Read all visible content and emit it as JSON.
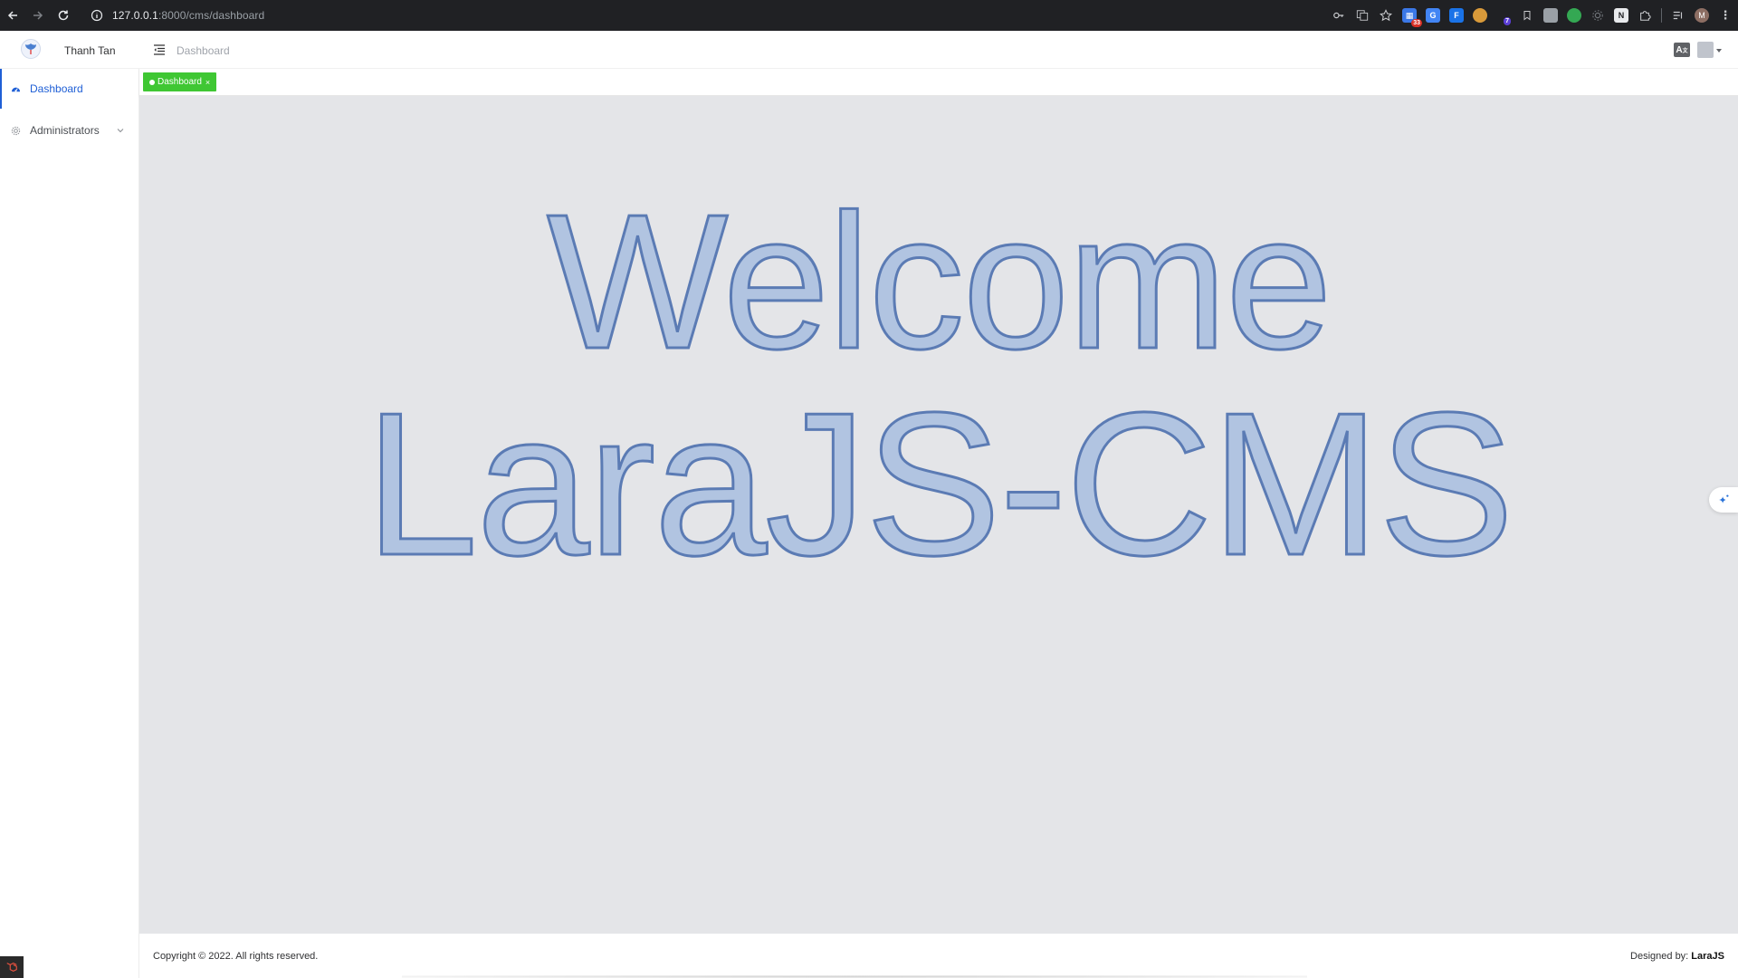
{
  "browser": {
    "url_host": "127.0.0.1",
    "url_path": ":8000/cms/dashboard",
    "extension_badges": {
      "first": "33",
      "second": "7"
    },
    "profile_initial": "M"
  },
  "header": {
    "user_name": "Thanh Tan",
    "breadcrumb": "Dashboard",
    "lang_icon_text": "A"
  },
  "sidebar": {
    "items": [
      {
        "label": "Dashboard",
        "icon": "dashboard-icon",
        "active": true
      },
      {
        "label": "Administrators",
        "icon": "gear-icon",
        "active": false
      }
    ]
  },
  "tags": {
    "items": [
      {
        "label": "Dashboard",
        "close": "×"
      }
    ]
  },
  "main": {
    "welcome_line1": "Welcome",
    "welcome_line2": "LaraJS-CMS"
  },
  "footer": {
    "copyright": "Copyright © 2022. All rights reserved.",
    "designed_prefix": "Designed by: ",
    "designed_brand": "LaraJS"
  },
  "colors": {
    "accent": "#1f5fd6",
    "tag_green": "#3fc733",
    "content_bg": "#e4e5e8",
    "welcome_fill": "#b1c4e1",
    "welcome_stroke": "#5b7bb4"
  }
}
